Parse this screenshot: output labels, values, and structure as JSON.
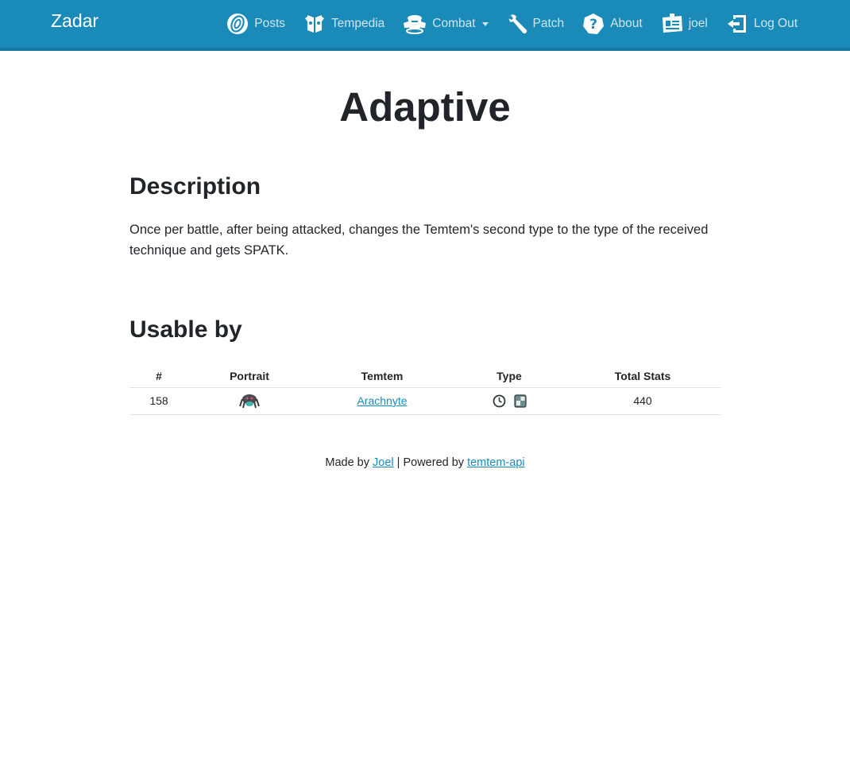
{
  "navbar": {
    "brand": "Zadar",
    "items": [
      {
        "label": "Posts",
        "icon": "posts-icon"
      },
      {
        "label": "Tempedia",
        "icon": "tempedia-icon"
      },
      {
        "label": "Combat",
        "icon": "combat-icon",
        "dropdown": true
      },
      {
        "label": "Patch",
        "icon": "wrench-icon"
      },
      {
        "label": "About",
        "icon": "question-icon"
      },
      {
        "label": "joel",
        "icon": "id-card-icon"
      },
      {
        "label": "Log Out",
        "icon": "logout-icon"
      }
    ],
    "colors": {
      "background": "#1a8bb8",
      "text": "#cfe6f1",
      "brand": "#ffffff"
    }
  },
  "page": {
    "title": "Adaptive",
    "description_heading": "Description",
    "description": "Once per battle, after being attacked, changes the Temtem's second type to the type of the received technique and gets SPATK.",
    "usable_heading": "Usable by"
  },
  "table": {
    "headers": [
      "#",
      "Portrait",
      "Temtem",
      "Type",
      "Total Stats"
    ],
    "rows": [
      {
        "number": "158",
        "portrait": "arachnyte-portrait",
        "temtem": "Arachnyte",
        "types": [
          "mental-type-icon",
          "toxic-type-icon"
        ],
        "total_stats": "440"
      }
    ]
  },
  "footer": {
    "made_by": "Made by",
    "author": "Joel",
    "separator": "| Powered by",
    "api": "temtem-api"
  }
}
